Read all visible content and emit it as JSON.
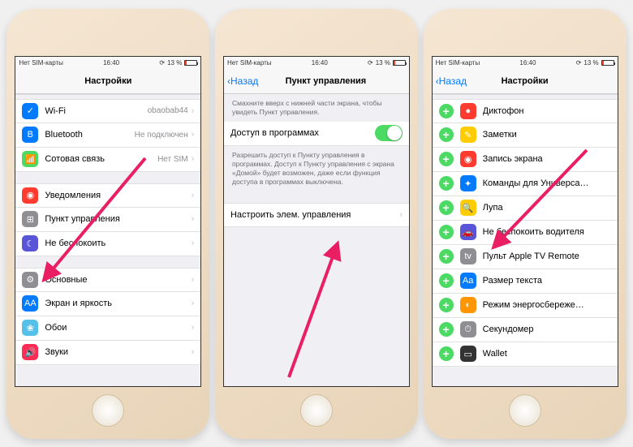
{
  "status": {
    "carrier": "Нет SIM-карты",
    "time": "16:40",
    "battery": "13 %"
  },
  "p1": {
    "title": "Настройки",
    "g1": [
      {
        "label": "Wi-Fi",
        "value": "obaobab44",
        "iconBg": "#007aff",
        "glyph": "✓"
      },
      {
        "label": "Bluetooth",
        "value": "Не подключен",
        "iconBg": "#007aff",
        "glyph": "B"
      },
      {
        "label": "Сотовая связь",
        "value": "Нет SIM",
        "iconBg": "#4cd964",
        "glyph": "📶"
      }
    ],
    "g2": [
      {
        "label": "Уведомления",
        "iconBg": "#ff3b30",
        "glyph": "◉"
      },
      {
        "label": "Пункт управления",
        "iconBg": "#8e8e93",
        "glyph": "⊞"
      },
      {
        "label": "Не беспокоить",
        "iconBg": "#5856d6",
        "glyph": "☾"
      }
    ],
    "g3": [
      {
        "label": "Основные",
        "iconBg": "#8e8e93",
        "glyph": "⚙"
      },
      {
        "label": "Экран и яркость",
        "iconBg": "#007aff",
        "glyph": "AA"
      },
      {
        "label": "Обои",
        "iconBg": "#55c1e8",
        "glyph": "❀"
      },
      {
        "label": "Звуки",
        "iconBg": "#ff2d55",
        "glyph": "🔊"
      }
    ]
  },
  "p2": {
    "back": "Назад",
    "title": "Пункт управления",
    "hint": "Смахните вверх с нижней части экрана, чтобы увидеть Пункт управления.",
    "toggleRow": "Доступ в программах",
    "toggleHint": "Разрешить доступ к Пункту управления в программах. Доступ к Пункту управления с экрана «Домой» будет возможен, даже если функция доступа в программах выключена.",
    "customize": "Настроить элем. управления"
  },
  "p3": {
    "back": "Назад",
    "title": "Настройки",
    "items": [
      {
        "label": "Диктофон",
        "iconBg": "#ff3b30",
        "glyph": "●"
      },
      {
        "label": "Заметки",
        "iconBg": "#ffcc00",
        "glyph": "✎"
      },
      {
        "label": "Запись экрана",
        "iconBg": "#ff3b30",
        "glyph": "◉"
      },
      {
        "label": "Команды для Универса…",
        "iconBg": "#007aff",
        "glyph": "✦"
      },
      {
        "label": "Лупа",
        "iconBg": "#ffcc00",
        "glyph": "🔍"
      },
      {
        "label": "Не беспокоить водителя",
        "iconBg": "#5856d6",
        "glyph": "🚗"
      },
      {
        "label": "Пульт Apple TV Remote",
        "iconBg": "#8e8e93",
        "glyph": "tv"
      },
      {
        "label": "Размер текста",
        "iconBg": "#007aff",
        "glyph": "Aa"
      },
      {
        "label": "Режим энергосбереже…",
        "iconBg": "#ff9500",
        "glyph": "◐"
      },
      {
        "label": "Секундомер",
        "iconBg": "#8e8e93",
        "glyph": "⏱"
      },
      {
        "label": "Wallet",
        "iconBg": "#333333",
        "glyph": "▭"
      }
    ]
  }
}
